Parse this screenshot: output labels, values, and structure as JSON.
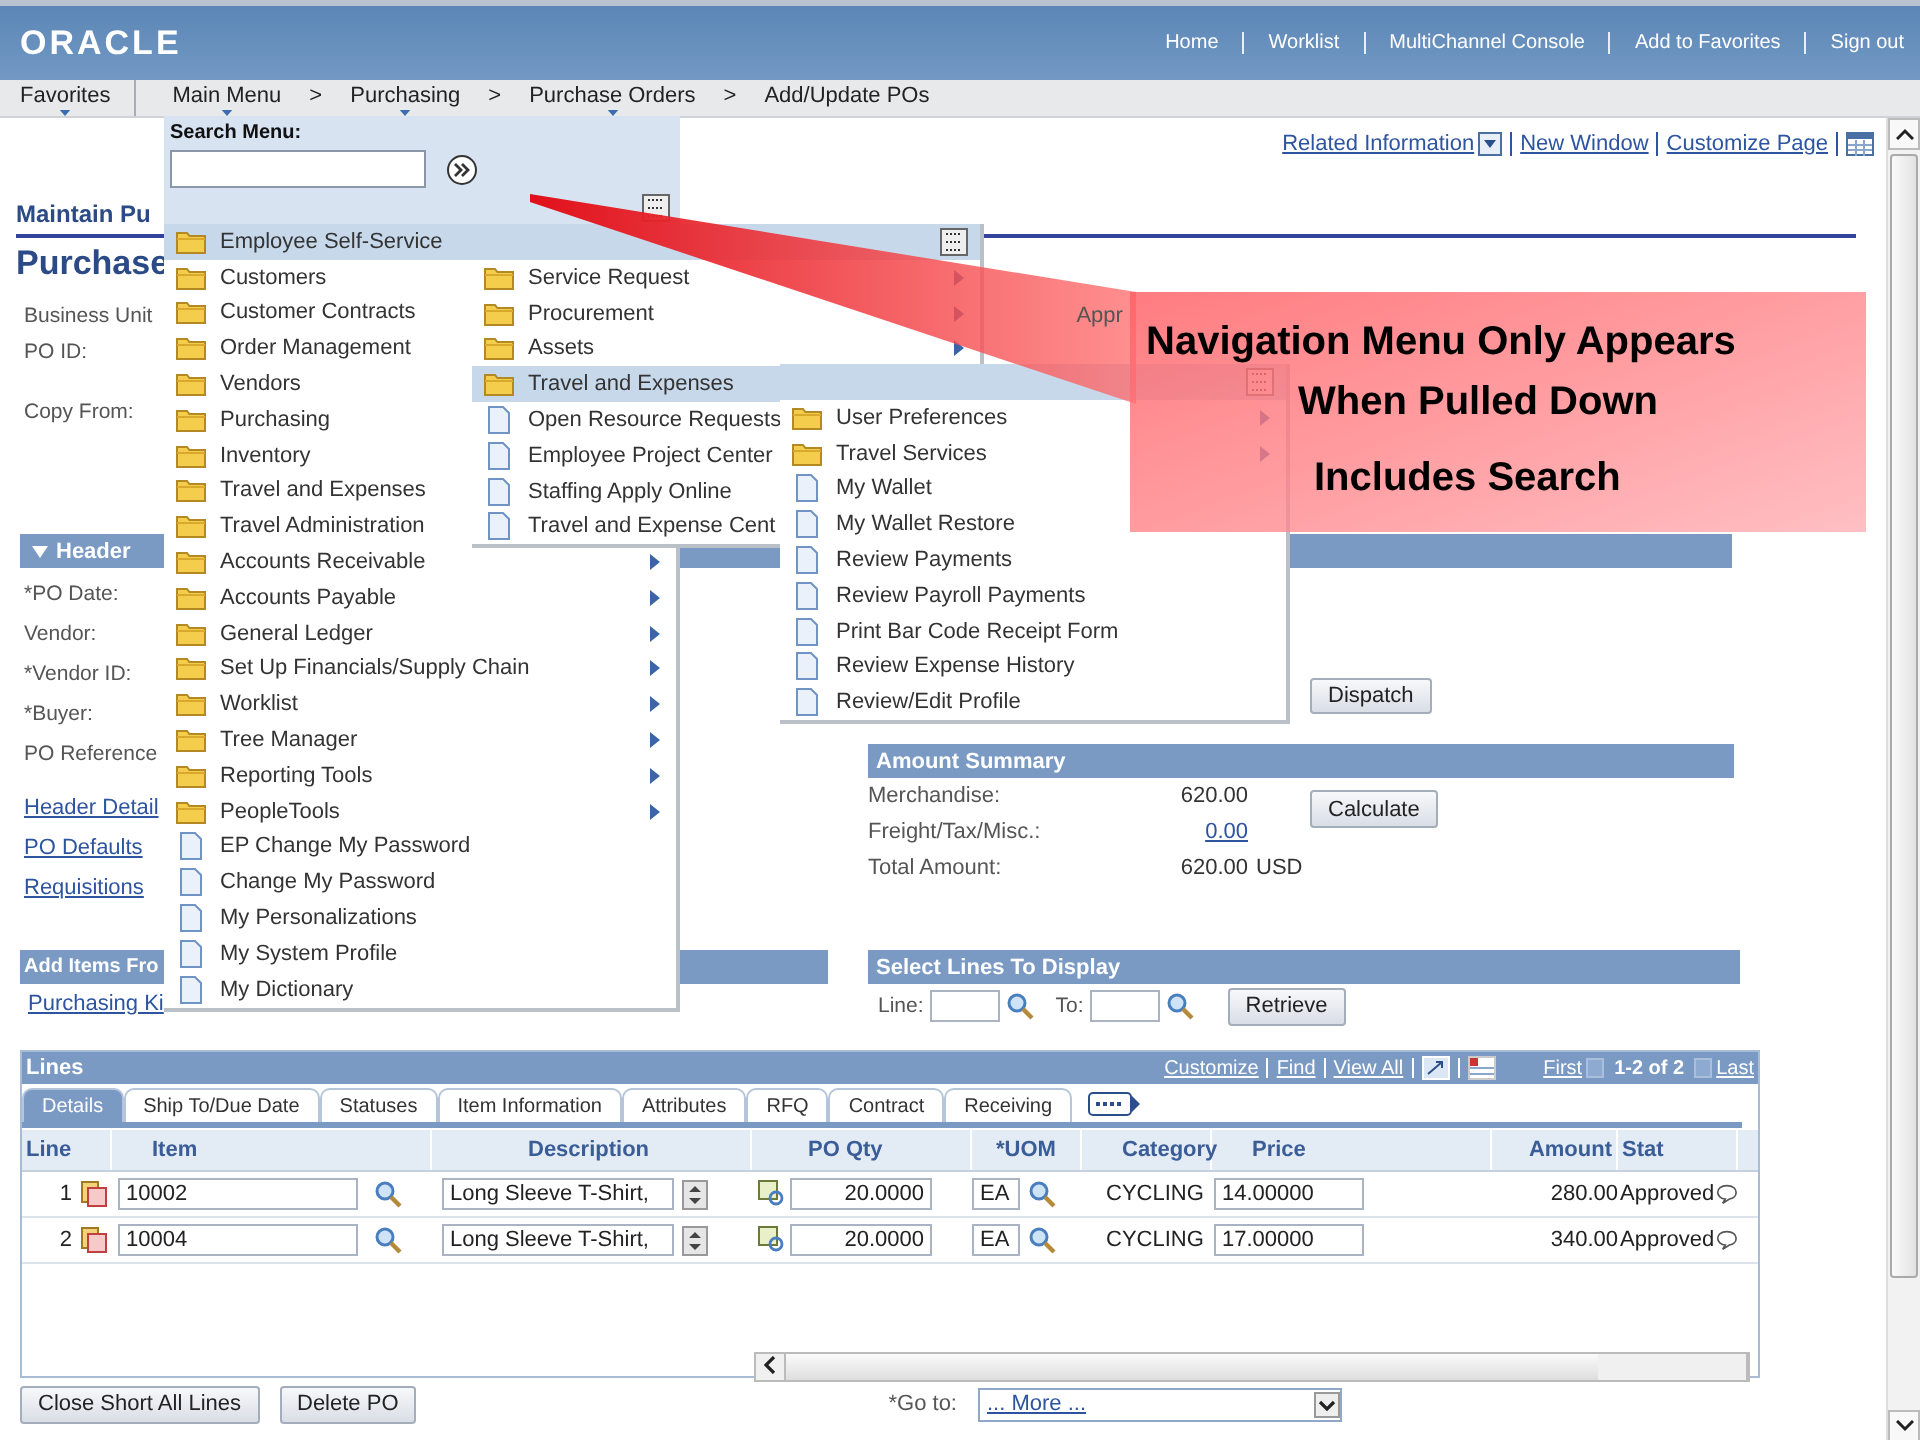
{
  "topbar": {
    "logo": "ORACLE",
    "links": [
      "Home",
      "Worklist",
      "MultiChannel Console",
      "Add to Favorites",
      "Sign out"
    ]
  },
  "navbar": {
    "favorites": {
      "label": "Favorites",
      "dropdown": true
    },
    "items": [
      {
        "label": "Main Menu",
        "dropdown": true
      },
      {
        "separator": ">",
        "label": "Purchasing",
        "dropdown": true
      },
      {
        "separator": ">",
        "label": "Purchase Orders",
        "dropdown": true
      },
      {
        "separator": ">",
        "label": "Add/Update POs",
        "dropdown": false
      }
    ]
  },
  "page_links": [
    {
      "label": "Related Information",
      "dropdown": true
    },
    {
      "label": "New Window",
      "dropdown": false
    },
    {
      "label": "Customize Page",
      "dropdown": false
    }
  ],
  "page": {
    "breadcrumb": "Maintain Pu",
    "title": "Purchase",
    "fields": [
      "Business Unit",
      "PO ID:",
      "Copy From:"
    ],
    "status_label": "Appr"
  },
  "header_section": {
    "title": "Header",
    "expanded": true,
    "fields": [
      "*PO Date:",
      "Vendor:",
      "*Vendor ID:",
      "*Buyer:",
      "PO Reference"
    ],
    "links": [
      "Header Detail",
      "PO Defaults",
      "Requisitions"
    ]
  },
  "dispatch_button": "Dispatch",
  "amount_summary": {
    "title": "Amount Summary",
    "rows": [
      {
        "label": "Merchandise:",
        "value": "620.00",
        "link": false
      },
      {
        "label": "Freight/Tax/Misc.:",
        "value": "0.00",
        "link": true
      },
      {
        "label": "Total Amount:",
        "value": "620.00",
        "link": false,
        "currency": "USD"
      }
    ],
    "button": "Calculate"
  },
  "add_items": {
    "title": "Add Items Fro",
    "links": [
      "Purchasing Ki"
    ]
  },
  "select_lines": {
    "title": "Select Lines To Display",
    "line_label": "Line:",
    "to_label": "To:",
    "button": "Retrieve"
  },
  "lines": {
    "title": "Lines",
    "nav_links": [
      "Customize",
      "Find",
      "View All"
    ],
    "first": "First",
    "range": "1-2 of 2",
    "last": "Last",
    "tabs": [
      {
        "label": "Details",
        "selected": true
      },
      {
        "label": "Ship To/Due Date",
        "selected": false
      },
      {
        "label": "Statuses",
        "selected": false
      },
      {
        "label": "Item Information",
        "selected": false
      },
      {
        "label": "Attributes",
        "selected": false
      },
      {
        "label": "RFQ",
        "selected": false
      },
      {
        "label": "Contract",
        "selected": false
      },
      {
        "label": "Receiving",
        "selected": false
      }
    ],
    "columns": [
      "Line",
      "Item",
      "Description",
      "PO Qty",
      "*UOM",
      "Category",
      "Price",
      "Amount",
      "Stat"
    ],
    "rows": [
      {
        "line": "1",
        "item": "10002",
        "description": "Long Sleeve T-Shirt,",
        "po_qty": "20.0000",
        "uom": "EA",
        "category": "CYCLING",
        "price": "14.00000",
        "amount": "280.00",
        "status": "Approved"
      },
      {
        "line": "2",
        "item": "10004",
        "description": "Long Sleeve T-Shirt,",
        "po_qty": "20.0000",
        "uom": "EA",
        "category": "CYCLING",
        "price": "17.00000",
        "amount": "340.00",
        "status": "Approved"
      }
    ]
  },
  "footer": {
    "buttons": [
      "Close Short All Lines",
      "Delete PO"
    ],
    "goto_label": "*Go to:",
    "goto_value": "... More ..."
  },
  "menu": {
    "search_label": "Search Menu:",
    "levels": [
      {
        "items": [
          {
            "label": "Employee Self-Service",
            "kind": "folder",
            "selected": true
          },
          {
            "label": "Customers",
            "kind": "folder",
            "selected": false
          },
          {
            "label": "Customer Contracts",
            "kind": "folder",
            "selected": false
          },
          {
            "label": "Order Management",
            "kind": "folder",
            "selected": false
          },
          {
            "label": "Vendors",
            "kind": "folder",
            "selected": false
          },
          {
            "label": "Purchasing",
            "kind": "folder",
            "selected": false
          },
          {
            "label": "Inventory",
            "kind": "folder",
            "selected": false
          },
          {
            "label": "Travel and Expenses",
            "kind": "folder",
            "selected": false
          },
          {
            "label": "Travel Administration",
            "kind": "folder",
            "selected": false
          },
          {
            "label": "Accounts Receivable",
            "kind": "folder",
            "selected": false
          },
          {
            "label": "Accounts Payable",
            "kind": "folder",
            "selected": false
          },
          {
            "label": "General Ledger",
            "kind": "folder",
            "selected": false
          },
          {
            "label": "Set Up Financials/Supply Chain",
            "kind": "folder",
            "selected": false
          },
          {
            "label": "Worklist",
            "kind": "folder",
            "selected": false
          },
          {
            "label": "Tree Manager",
            "kind": "folder",
            "selected": false
          },
          {
            "label": "Reporting Tools",
            "kind": "folder",
            "selected": false
          },
          {
            "label": "PeopleTools",
            "kind": "folder",
            "selected": false
          },
          {
            "label": "EP Change My Password",
            "kind": "page",
            "selected": false
          },
          {
            "label": "Change My Password",
            "kind": "page",
            "selected": false
          },
          {
            "label": "My Personalizations",
            "kind": "page",
            "selected": false
          },
          {
            "label": "My System Profile",
            "kind": "page",
            "selected": false
          },
          {
            "label": "My Dictionary",
            "kind": "page",
            "selected": false
          }
        ]
      },
      {
        "items": [
          {
            "label": "Service Request",
            "kind": "folder",
            "selected": false
          },
          {
            "label": "Procurement",
            "kind": "folder",
            "selected": false
          },
          {
            "label": "Assets",
            "kind": "folder",
            "selected": false
          },
          {
            "label": "Travel and Expenses",
            "kind": "folder",
            "selected": true
          },
          {
            "label": "Open Resource Requests",
            "kind": "page",
            "selected": false
          },
          {
            "label": "Employee Project Center",
            "kind": "page",
            "selected": false
          },
          {
            "label": "Staffing Apply Online",
            "kind": "page",
            "selected": false
          },
          {
            "label": "Travel and Expense Cent",
            "kind": "page",
            "selected": false
          }
        ]
      },
      {
        "items": [
          {
            "label": "User Preferences",
            "kind": "folder",
            "selected": false
          },
          {
            "label": "Travel Services",
            "kind": "folder",
            "selected": false
          },
          {
            "label": "My Wallet",
            "kind": "page",
            "selected": false
          },
          {
            "label": "My Wallet Restore",
            "kind": "page",
            "selected": false
          },
          {
            "label": "Review Payments",
            "kind": "page",
            "selected": false
          },
          {
            "label": "Review Payroll Payments",
            "kind": "page",
            "selected": false
          },
          {
            "label": "Print Bar Code Receipt Form",
            "kind": "page",
            "selected": false
          },
          {
            "label": "Review Expense History",
            "kind": "page",
            "selected": false
          },
          {
            "label": "Review/Edit Profile",
            "kind": "page",
            "selected": false
          }
        ]
      }
    ]
  },
  "callout": {
    "lines": [
      "Navigation Menu Only Appears",
      "When Pulled Down",
      "Includes Search"
    ]
  }
}
